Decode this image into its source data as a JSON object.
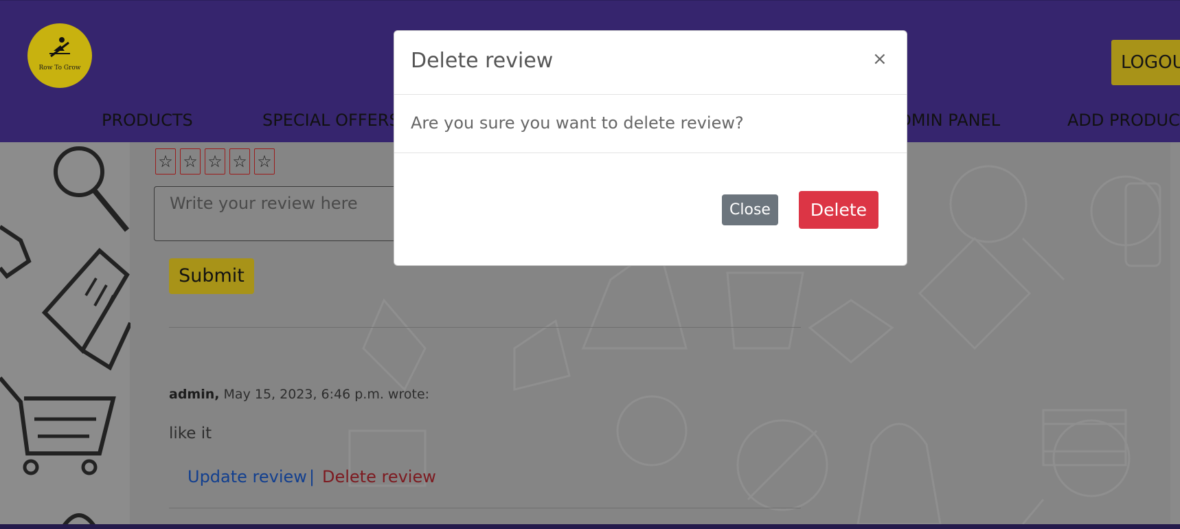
{
  "logo": {
    "text": "Row To Grow"
  },
  "header": {
    "logout_label": "LOGOUT",
    "nav": [
      "PRODUCTS",
      "SPECIAL OFFERS",
      "ADMIN PANEL",
      "ADD PRODUCT"
    ]
  },
  "review_form": {
    "star_icon": "star-outline-icon",
    "placeholder": "Write your review here",
    "submit_label": "Submit"
  },
  "review": {
    "author": "admin,",
    "meta": "May 15, 2023, 6:46 p.m. wrote:",
    "text": "like it",
    "update_label": "Update review",
    "separator": "|",
    "delete_label": "Delete review"
  },
  "modal": {
    "title": "Delete review",
    "close_icon": "×",
    "body": "Are you sure you want to delete review?",
    "close_label": "Close",
    "delete_label": "Delete"
  },
  "colors": {
    "header": "#36256e",
    "accent": "#c8b20f",
    "danger": "#dc3545",
    "secondary": "#6c757d"
  }
}
